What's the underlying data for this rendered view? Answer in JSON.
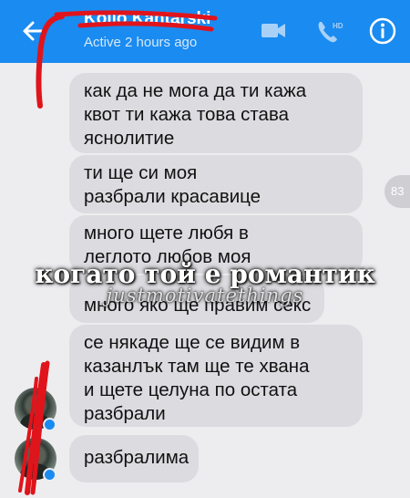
{
  "header": {
    "title": "Kolio Kantarski",
    "status": "Active 2 hours ago",
    "back_icon": "back-arrow-icon",
    "video_icon": "video-camera-icon",
    "call_icon": "phone-hd-icon",
    "info_icon": "info-icon",
    "color": "#1a8bf0"
  },
  "messages": [
    {
      "text": "как да не мога да ти кажа\nквот ти кажа това става\nяснолитие"
    },
    {
      "text": "ти ще си моя\nразбрали красавице"
    },
    {
      "text": "много щете любя в\nлеглото  любов моя"
    },
    {
      "text": "много яко ще правим секс"
    },
    {
      "text": "се някаде ще се видим в\nказанлък  там ще те хвана\nи щете целуна по остата\nразбрали"
    },
    {
      "text": "разбралима"
    }
  ],
  "unread_count": "83",
  "overlay": {
    "caption": "когато той е романтик",
    "watermark": "justmotivatethings"
  }
}
